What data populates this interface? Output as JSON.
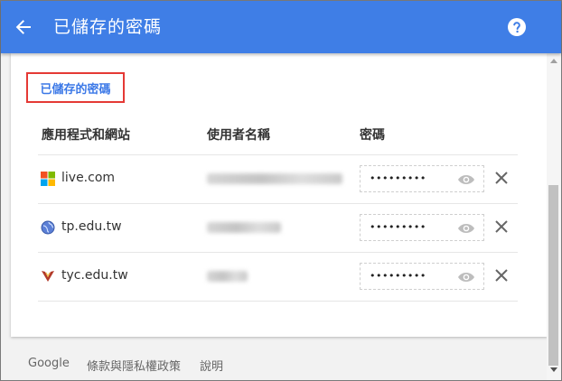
{
  "header": {
    "title": "已儲存的密碼",
    "back_icon": "arrow-left-icon",
    "help_icon": "help-circle-icon"
  },
  "section": {
    "link_label": "已儲存的密碼"
  },
  "table": {
    "columns": [
      "應用程式和網站",
      "使用者名稱",
      "密碼"
    ],
    "rows": [
      {
        "site": "live.com",
        "site_icon": "microsoft-logo-icon",
        "password_mask": "•••••••••"
      },
      {
        "site": "tp.edu.tw",
        "site_icon": "globe-icon",
        "password_mask": "•••••••••"
      },
      {
        "site": "tyc.edu.tw",
        "site_icon": "tyc-logo-icon",
        "password_mask": "•••••••••"
      }
    ]
  },
  "footer": {
    "links": [
      "Google",
      "條款與隱私權政策",
      "說明"
    ]
  },
  "colors": {
    "header_bg": "#3f7ee6",
    "link_blue": "#3b78e7",
    "highlight_red": "#e53935"
  }
}
